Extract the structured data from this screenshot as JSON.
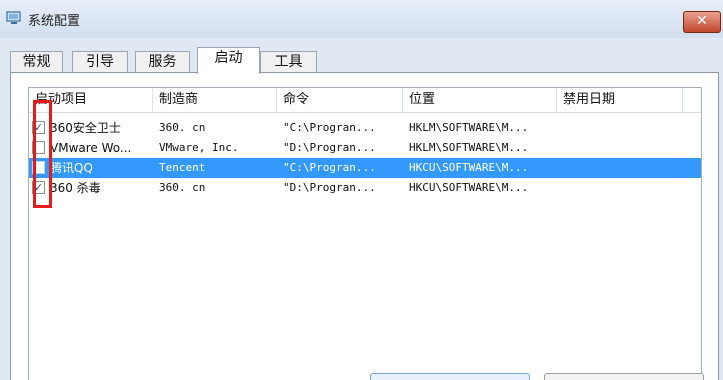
{
  "window": {
    "title": "系统配置",
    "close_glyph": "✕",
    "icon": "computer-window-icon"
  },
  "tabs": [
    {
      "label": "常规",
      "active": false
    },
    {
      "label": "引导",
      "active": false
    },
    {
      "label": "服务",
      "active": false
    },
    {
      "label": "启动",
      "active": true
    },
    {
      "label": "工具",
      "active": false
    }
  ],
  "columns": [
    "启动项目",
    "制造商",
    "命令",
    "位置",
    "禁用日期"
  ],
  "rows": [
    {
      "checked": true,
      "check_glyph": "✓",
      "name": "360安全卫士",
      "maker": "360. cn",
      "command": "\"C:\\Progran...",
      "location": "HKLM\\SOFTWARE\\M...",
      "disabled": ""
    },
    {
      "checked": false,
      "check_glyph": "",
      "name": "VMware Wo...",
      "maker": "VMware, Inc.",
      "command": "\"D:\\Progran...",
      "location": "HKLM\\SOFTWARE\\M...",
      "disabled": ""
    },
    {
      "checked": false,
      "check_glyph": "",
      "name": "腾讯QQ",
      "maker": "Tencent",
      "command": "\"C:\\Progran...",
      "location": "HKCU\\SOFTWARE\\M...",
      "disabled": "",
      "selected": true
    },
    {
      "checked": true,
      "check_glyph": "✓",
      "name": "360 杀毒",
      "maker": "360. cn",
      "command": "\"D:\\Progran...",
      "location": "HKCU\\SOFTWARE\\M...",
      "disabled": ""
    }
  ],
  "colors": {
    "selection": "#3399ff",
    "annotation": "#e51b1b",
    "close": "#c1472e"
  }
}
